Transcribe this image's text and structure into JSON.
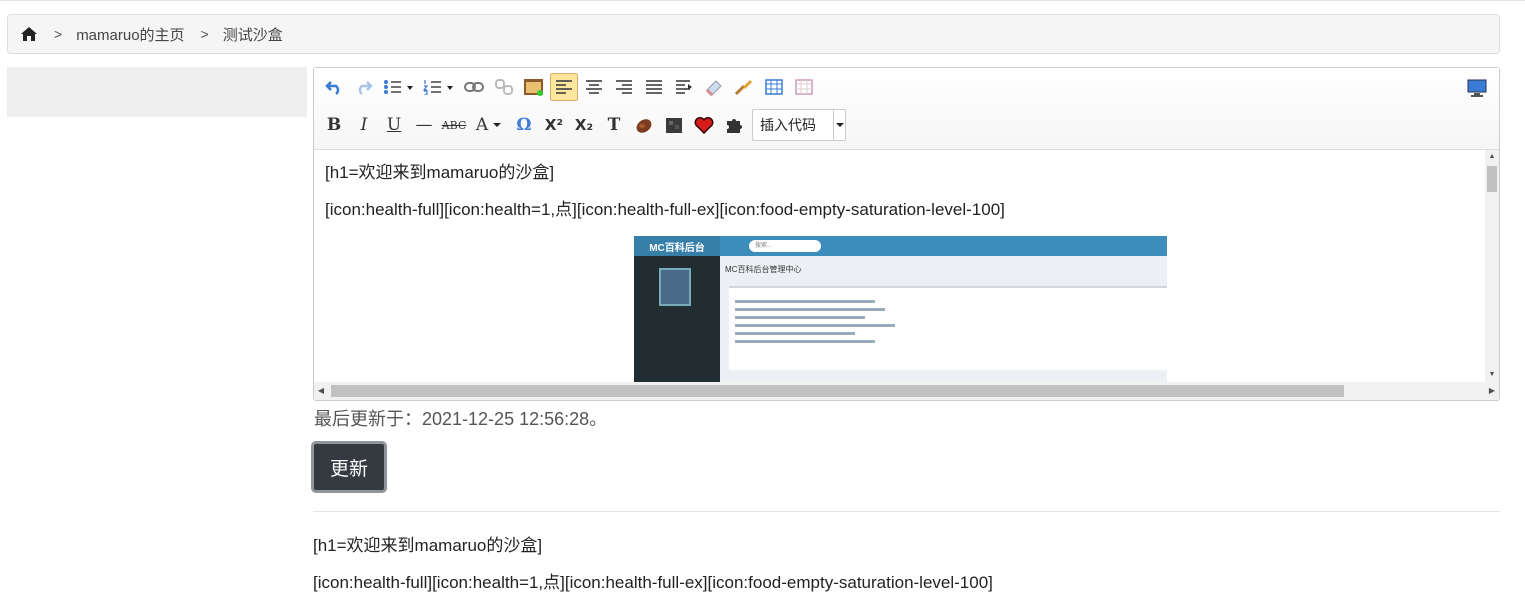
{
  "breadcrumb": {
    "home_icon": "home-icon",
    "separator": ">",
    "items": [
      "mamaruo的主页",
      "测试沙盒"
    ]
  },
  "editor": {
    "toolbar_row1": [
      "undo-icon",
      "redo-icon",
      "unordered-list-icon",
      "ordered-list-icon",
      "link-icon",
      "unlink-icon",
      "image-icon",
      "align-left-icon",
      "align-center-icon",
      "align-right-icon",
      "align-justify-icon",
      "indent-icon",
      "eraser-icon",
      "format-brush-icon",
      "table-icon",
      "table-delete-icon"
    ],
    "toolbar_row2": {
      "bold": "B",
      "italic": "I",
      "underline": "U",
      "hr": "—",
      "strike": "ABC",
      "font_color": "A",
      "special_char": "Ω",
      "superscript": "X²",
      "subscript": "X₂",
      "remove_format": "T"
    },
    "insert_code_label": "插入代码",
    "active_tool": "align-left",
    "content_lines": [
      "[h1=欢迎来到mamaruo的沙盒]",
      "[icon:health-full][icon:health=1,点][icon:health-full-ex][icon:food-empty-saturation-level-100]"
    ],
    "embedded_image": {
      "brand": "MC百科后台",
      "search_placeholder": "搜索...",
      "page_title": "MC百科后台管理中心"
    }
  },
  "last_updated": "最后更新于：2021-12-25 12:56:28。",
  "update_button": "更新",
  "preview_lines": [
    "[h1=欢迎来到mamaruo的沙盒]",
    "[icon:health-full][icon:health=1,点][icon:health-full-ex][icon:food-empty-saturation-level-100]"
  ],
  "colors": {
    "button_bg": "#343a40",
    "active_tool_bg": "#ffe69f",
    "embedded_header": "#3c8dbc"
  }
}
